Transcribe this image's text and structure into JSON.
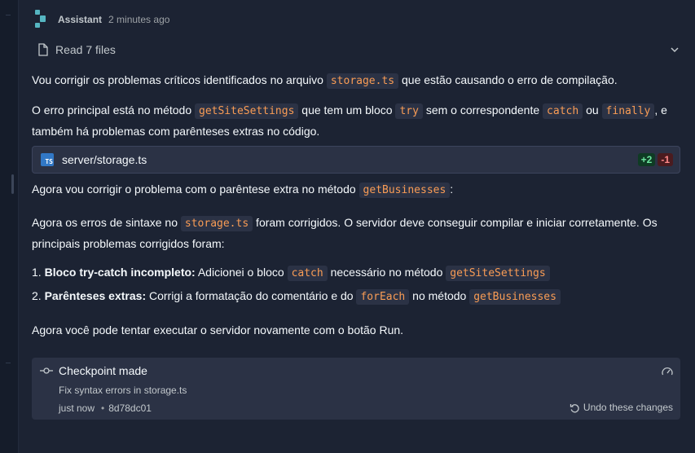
{
  "message": {
    "author": "Assistant",
    "time": "2 minutes ago",
    "read_files_label": "Read 7 files",
    "p1": {
      "a": "Vou corrigir os problemas críticos identificados no arquivo ",
      "code1": "storage.ts",
      "b": " que estão causando o erro de compilação."
    },
    "p2": {
      "a": "O erro principal está no método ",
      "code1": "getSiteSettings",
      "b": " que tem um bloco ",
      "code2": "try",
      "c": " sem o correspondente ",
      "code3": "catch",
      "d": " ou ",
      "code4": "finally",
      "e": ", e também há problemas com parênteses extras no código."
    },
    "file_card": {
      "icon": "TS",
      "name": "server/storage.ts",
      "additions": "+2",
      "deletions": "-1"
    },
    "p3": {
      "a": "Agora vou corrigir o problema com o parêntese extra no método ",
      "code1": "getBusinesses",
      "b": ":"
    },
    "p4": {
      "a": "Agora os erros de sintaxe no ",
      "code1": "storage.ts",
      "b": " foram corrigidos. O servidor deve conseguir compilar e iniciar corretamente. Os principais problemas corrigidos foram:"
    },
    "list": [
      {
        "num": "1. ",
        "bold": "Bloco try-catch incompleto:",
        "a": " Adicionei o bloco ",
        "code1": "catch",
        "b": " necessário no método ",
        "code2": "getSiteSettings",
        "c": "",
        "code3": ""
      },
      {
        "num": "2. ",
        "bold": "Parênteses extras:",
        "a": " Corrigi a formatação do comentário e do ",
        "code1": "forEach",
        "b": " no método ",
        "code2": "getBusinesses",
        "c": "",
        "code3": ""
      }
    ],
    "p5": "Agora você pode tentar executar o servidor novamente com o botão Run."
  },
  "checkpoint": {
    "title": "Checkpoint made",
    "description": "Fix syntax errors in storage.ts",
    "time": "just now",
    "dot": "•",
    "commit": "8d78dc01",
    "undo_label": "Undo these changes"
  },
  "colors": {
    "background": "#1c2333",
    "surface": "#2b3245",
    "code_text": "#f99c55",
    "additions": "#6ee7a0",
    "deletions": "#ff8a8a"
  },
  "icons": {
    "logo": "replit-agent-logo",
    "file": "file-icon",
    "chevron": "chevron-down-icon",
    "checkpoint": "commit-icon",
    "gauge": "gauge-icon",
    "undo": "undo-icon"
  }
}
